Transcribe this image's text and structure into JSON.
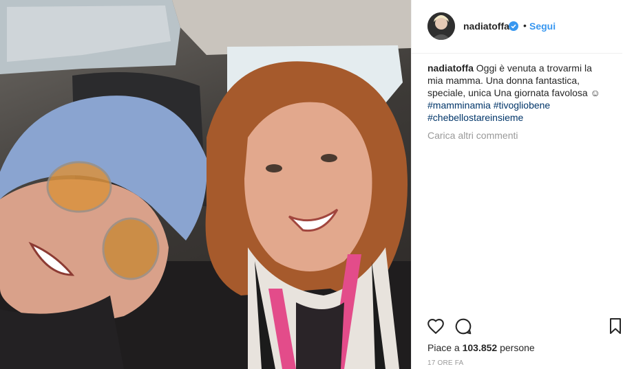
{
  "header": {
    "username": "nadiatoffa",
    "separator": "•",
    "follow_label": "Segui",
    "verified_icon": "verified-badge-icon",
    "accent_color": "#3897f0"
  },
  "caption": {
    "username": "nadiatoffa",
    "text": "Oggi è venuta a trovarmi la mia mamma. Una donna fantastica, speciale, unica Una giornata favolosa ☺",
    "hashtags": [
      "#mamminamia",
      "#tivogliobene",
      "#chebellostareinsieme"
    ]
  },
  "comments": {
    "load_more_label": "Carica altri commenti"
  },
  "actions": {
    "like_icon": "heart-icon",
    "comment_icon": "comment-icon",
    "save_icon": "bookmark-icon"
  },
  "likes": {
    "prefix": "Piace a",
    "count": "103.852",
    "suffix": "persone"
  },
  "timestamp": "17 ORE FA"
}
